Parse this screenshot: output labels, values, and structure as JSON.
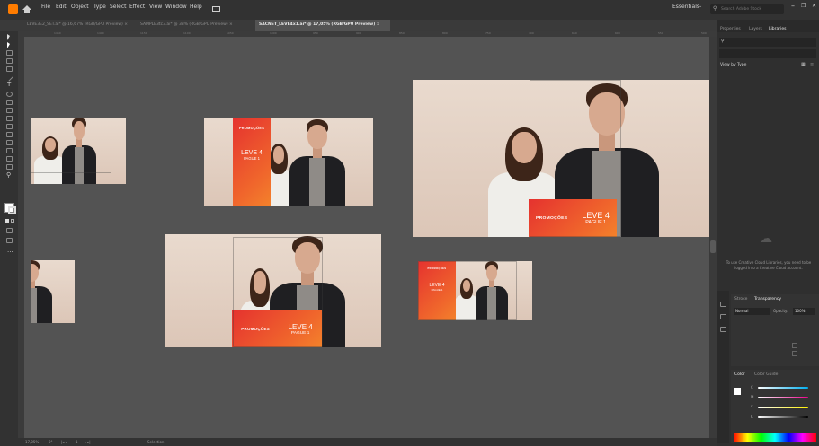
{
  "menubar": {
    "items": [
      "File",
      "Edit",
      "Object",
      "Type",
      "Select",
      "Effect",
      "View",
      "Window",
      "Help"
    ],
    "workspace": "Essentials",
    "search_placeholder": "Search Adobe Stock"
  },
  "tabs": [
    {
      "label": "LEVE3E2_SET.ai* @ 16,67% (RGB/GPU Preview)",
      "active": false
    },
    {
      "label": "SAMPLE3tc3.ai* @ 33% (RGB/GPU Preview)",
      "active": false
    },
    {
      "label": "SACNET_LEVE4x1.ai* @ 17,05% (RGB/GPU Preview)",
      "active": true
    }
  ],
  "ruler_ticks": [
    "1450",
    "1400",
    "1150",
    "1100",
    "1050",
    "1000",
    "950",
    "900",
    "850",
    "800",
    "750",
    "700",
    "650",
    "600",
    "550",
    "500"
  ],
  "promo": {
    "heading": "PROMOÇÕES",
    "big": "LEVE 4",
    "small": "PAGUE 1"
  },
  "panel": {
    "tabs": [
      "Properties",
      "Layers",
      "Libraries"
    ],
    "view_by": "View by Type",
    "libraries_message": "To use Creative Cloud Libraries, you need to be logged into a Creative Cloud account.",
    "stroke_tabs": [
      "Stroke",
      "Transparency"
    ],
    "blend_mode": "Normal",
    "opacity_label": "Opacity:",
    "opacity_value": "100%",
    "color_tabs": [
      "Color",
      "Color Guide"
    ],
    "channels": [
      "C",
      "M",
      "Y",
      "K"
    ]
  },
  "status": {
    "zoom": "17,05%",
    "rotation": "0°",
    "artboard_num": "1",
    "tool": "Selection"
  },
  "colors": {
    "canvas": "#535353",
    "promo_start": "#e5322f",
    "promo_end": "#f3822b",
    "jacket": "#1f1f22",
    "shirt_white": "#efeeea"
  }
}
